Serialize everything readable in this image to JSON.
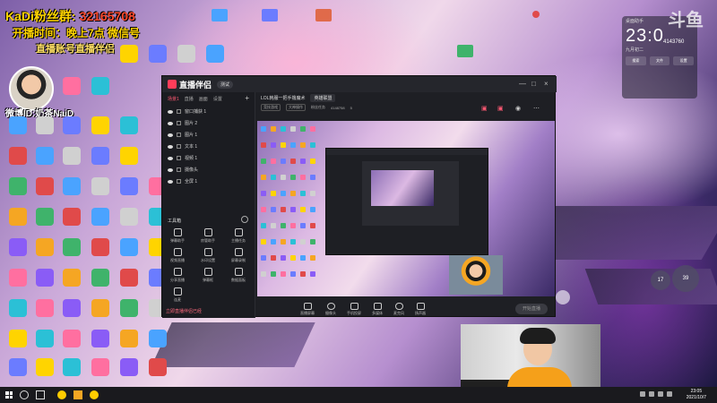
{
  "overlay": {
    "line1": "KaDi粉丝群:",
    "line1_num": "32165708",
    "line2": "开播时间：晚上7点 微信号",
    "line3": "直播账号直播伴侣",
    "streamer_id": "微博ID:奶茶NaiD"
  },
  "clock": {
    "header": "桌面助手",
    "time": "23:0",
    "date": "九月初二",
    "buttons": [
      "搜索",
      "文件",
      "设置"
    ]
  },
  "huya": {
    "logo": "斗鱼",
    "room": "4143760"
  },
  "app": {
    "name": "直播伴侣",
    "beta_label": "测试",
    "window_controls": [
      "—",
      "□",
      "×"
    ],
    "tabs": [
      "场景1",
      "直播",
      "画面",
      "设置"
    ],
    "active_tab": "场景1",
    "scenes": [
      {
        "label": "窗口捕获 1"
      },
      {
        "label": "图片 2"
      },
      {
        "label": "图片 1"
      },
      {
        "label": "文本 1"
      },
      {
        "label": "视频 1"
      },
      {
        "label": "摄像头"
      },
      {
        "label": "全屏 1"
      }
    ],
    "tools_title": "工具箱",
    "tools": [
      "弹幕助手",
      "房管助手",
      "主播任务",
      "视频直播",
      "水印设置",
      "屏幕录制",
      "分享直播",
      "弹幕框",
      "数据面板",
      "连麦"
    ],
    "bottom_note": "立即直播伴侣已经",
    "stream_title": "LOL韩服一把手撸魔术",
    "stream_category": "英雄联盟",
    "info": [
      "竞技游戏",
      "大神操作",
      "粉丝任务",
      "4148758",
      "5"
    ],
    "toolbar": [
      "直播屏幕",
      "摄像头",
      "手机投屏",
      "多媒体",
      "麦克风",
      "扬声器"
    ],
    "start_label": "开始直播"
  },
  "bubbles": [
    "17",
    "39",
    ""
  ],
  "taskbar": {
    "time": "23:05",
    "date": "2021/10/7"
  },
  "colors": {
    "accent": "#ff5872",
    "overlay_yellow": "#ffd400",
    "overlay_red": "#ff4a2e"
  }
}
